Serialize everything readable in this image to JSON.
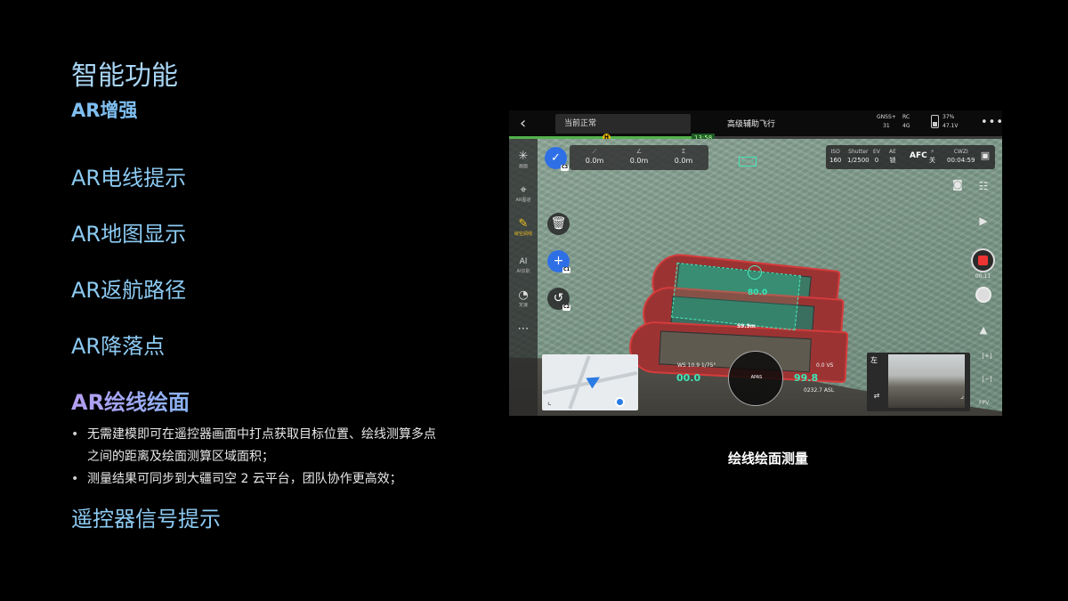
{
  "title": "智能功能",
  "subtitle": "AR增强",
  "features": [
    {
      "label": "AR电线提示"
    },
    {
      "label": "AR地图显示"
    },
    {
      "label": "AR返航路径"
    },
    {
      "label": "AR降落点"
    },
    {
      "label": "AR绘线绘面"
    },
    {
      "label": "遥控器信号提示"
    }
  ],
  "bullets": [
    "无需建模即可在遥控器画面中打点获取目标位置、绘线测算多点之间的距离及绘面测算区域面积；",
    "测量结果可同步到大疆司空 2 云平台，团队协作更高效；"
  ],
  "caption": "绘线绘面测量",
  "screen": {
    "flight_status": "当前正常",
    "flight_mode": "高级辅助飞行",
    "gnss_label": "GNSS+",
    "gnss_value": "31",
    "rc_label": "RC",
    "rc_net": "4G",
    "battery_pct": "37%",
    "battery_volt": "47.1V",
    "progress_marker": "H",
    "flight_time": "13:58",
    "accent_color": "#2f6fe6",
    "ar_color": "#3fe7b7",
    "tools": [
      {
        "icon": "grid-icon",
        "glyph": "✳",
        "label": "画面"
      },
      {
        "icon": "ar-icon",
        "glyph": "⌖",
        "label": "AR图道"
      },
      {
        "icon": "pen-icon",
        "glyph": "✎",
        "label": "绘空阅线"
      },
      {
        "icon": "ai-icon",
        "glyph": "AI",
        "label": "AI识别"
      },
      {
        "icon": "speed-icon",
        "glyph": "◔",
        "label": "定速"
      },
      {
        "icon": "more-icon",
        "glyph": "⋯",
        "label": ""
      }
    ],
    "measure": [
      {
        "glyph": "⟋",
        "value": "0.0m"
      },
      {
        "glyph": "∠",
        "value": "0.0m"
      },
      {
        "glyph": "Σ",
        "value": "0.0m"
      }
    ],
    "badges": {
      "c3": "C3",
      "c1": "C1",
      "c2": "C2"
    },
    "camera": {
      "iso_label": "ISO",
      "iso": "160",
      "shutter_label": "Shutter",
      "shutter": "1/2500",
      "ev_label": "EV",
      "ev": "0",
      "ae_label": "AE",
      "ae": "锁",
      "afc": "AFC",
      "off_label": "关",
      "storage": "CWZI",
      "remaining": "00:04:59"
    },
    "rec_time": "00:11",
    "ar_area_value": "80.0",
    "ar_line_value": "59.9m",
    "hud": {
      "left_speed": "00.0",
      "right_alt": "99.8",
      "ws_text": "WS 10.9 1/75°",
      "vs_text": "0.0 VS",
      "asl_text": "0232.7 ASL",
      "apas": "APAS"
    },
    "pip_side": "左",
    "fpv": "FPV"
  }
}
